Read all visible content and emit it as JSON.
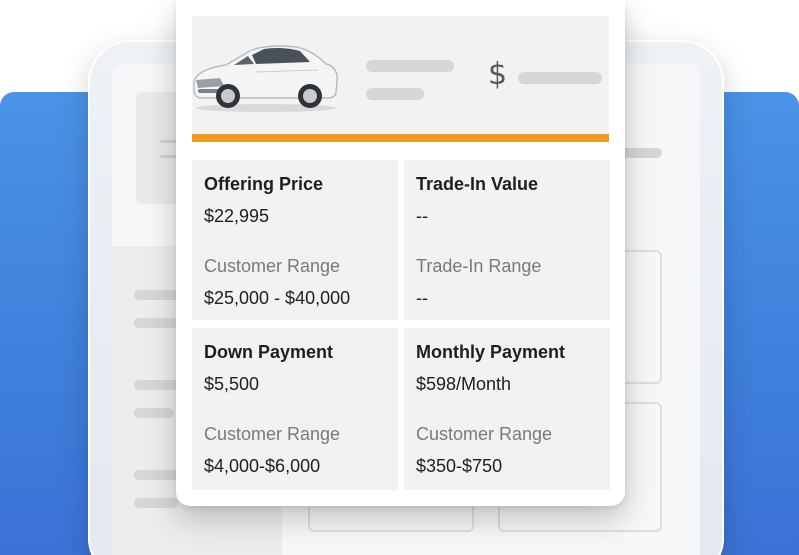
{
  "header": {
    "currency_symbol": "$"
  },
  "cells": [
    {
      "title": "Offering Price",
      "value": "$22,995",
      "sub_label": "Customer Range",
      "range": "$25,000 - $40,000"
    },
    {
      "title": "Trade-In Value",
      "value": "--",
      "sub_label": "Trade-In Range",
      "range": "--"
    },
    {
      "title": "Down Payment",
      "value": "$5,500",
      "sub_label": "Customer Range",
      "range": "$4,000-$6,000"
    },
    {
      "title": "Monthly Payment",
      "value": "$598/Month",
      "sub_label": "Customer Range",
      "range": "$350-$750"
    }
  ],
  "colors": {
    "accent": "#f29b23",
    "background_blue": "#3f7fdc",
    "cell_background": "#f2f2f2"
  },
  "icons": {
    "vehicle": "car-icon",
    "currency": "dollar-icon"
  }
}
